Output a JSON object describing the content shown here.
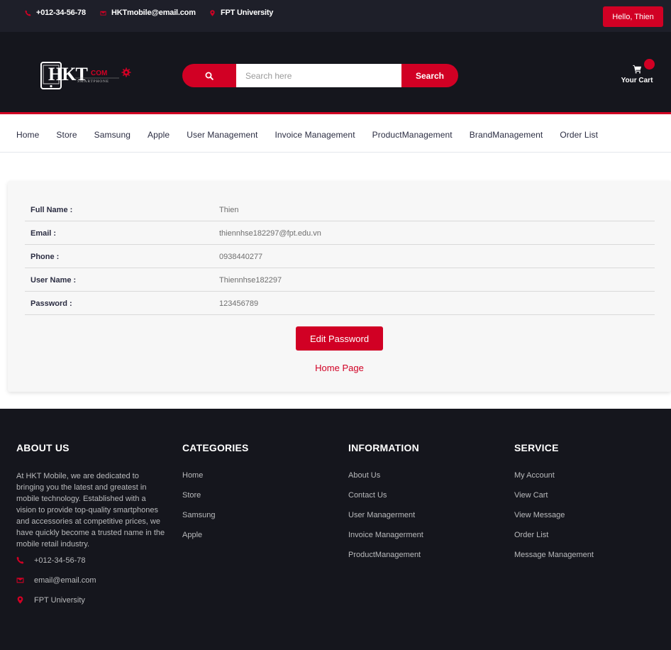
{
  "topbar": {
    "phone": "+012-34-56-78",
    "email": "HKTmobile@email.com",
    "location": "FPT University",
    "hello_button": "Hello, Thien"
  },
  "header": {
    "search_icon_label": "",
    "search_placeholder": "Search here",
    "search_button": "Search",
    "cart_label": "Your Cart"
  },
  "nav": {
    "items": [
      "Home",
      "Store",
      "Samsung",
      "Apple",
      "User Management",
      "Invoice Management",
      "ProductManagement",
      "BrandManagement",
      "Order List"
    ]
  },
  "profile": {
    "rows": [
      {
        "label": "Full Name :",
        "value": "Thien"
      },
      {
        "label": "Email :",
        "value": "thiennhse182297@fpt.edu.vn"
      },
      {
        "label": "Phone :",
        "value": "0938440277"
      },
      {
        "label": "User Name :",
        "value": "Thiennhse182297"
      },
      {
        "label": "Password :",
        "value": "123456789"
      }
    ],
    "edit_button": "Edit Password",
    "home_link": "Home Page"
  },
  "footer": {
    "about": {
      "title": "ABOUT US",
      "text": "At HKT Mobile, we are dedicated to bringing you the latest and greatest in mobile technology. Established with a vision to provide top-quality smartphones and accessories at competitive prices, we have quickly become a trusted name in the mobile retail industry.",
      "phone": "+012-34-56-78",
      "email": "email@email.com",
      "location": "FPT University"
    },
    "categories": {
      "title": "CATEGORIES",
      "items": [
        "Home",
        "Store",
        "Samsung",
        "Apple"
      ]
    },
    "information": {
      "title": "INFORMATION",
      "items": [
        "About Us",
        "Contact Us",
        "User Managerment",
        "Invoice Managerment",
        "ProductManagement"
      ]
    },
    "service": {
      "title": "SERVICE",
      "items": [
        "My Account",
        "View Cart",
        "View Message",
        "Order List",
        "Message Management"
      ]
    }
  },
  "colors": {
    "accent": "#D10024",
    "dark_bg": "#15161D",
    "topbar_bg": "#1E1F29"
  },
  "icons": {
    "phone": "phone-icon",
    "email": "envelope-icon",
    "location": "map-marker-icon",
    "search": "search-icon",
    "cart": "shopping-cart-icon"
  }
}
